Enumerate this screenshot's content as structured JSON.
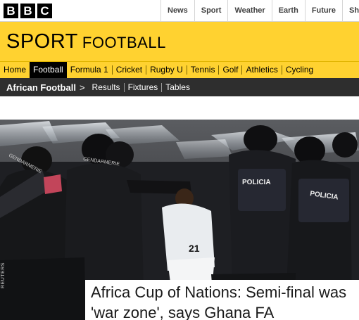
{
  "bbc": {
    "logo_letters": [
      "B",
      "B",
      "C"
    ],
    "nav": [
      "News",
      "Sport",
      "Weather",
      "Earth",
      "Future",
      "Sho"
    ]
  },
  "sport": {
    "title": "SPORT",
    "section": "FOOTBALL",
    "nav": [
      "Home",
      "Football",
      "Formula 1",
      "Cricket",
      "Rugby U",
      "Tennis",
      "Golf",
      "Athletics",
      "Cycling"
    ],
    "active": "Football"
  },
  "subnav": {
    "current": "African Football",
    "arrow": ">",
    "items": [
      "Results",
      "Fixtures",
      "Tables"
    ]
  },
  "hero": {
    "headline": "Africa Cup of Nations: Semi-final was 'war zone', says Ghana FA",
    "photo_credit": "REUTERS",
    "vest_labels": [
      "GENDARMERIE",
      "GENDARMERIE",
      "POLICIA",
      "POLICIA"
    ],
    "shirt_number": "21"
  },
  "colors": {
    "sport_yellow": "#ffd230",
    "subnav_dark": "#2e2e2e"
  }
}
